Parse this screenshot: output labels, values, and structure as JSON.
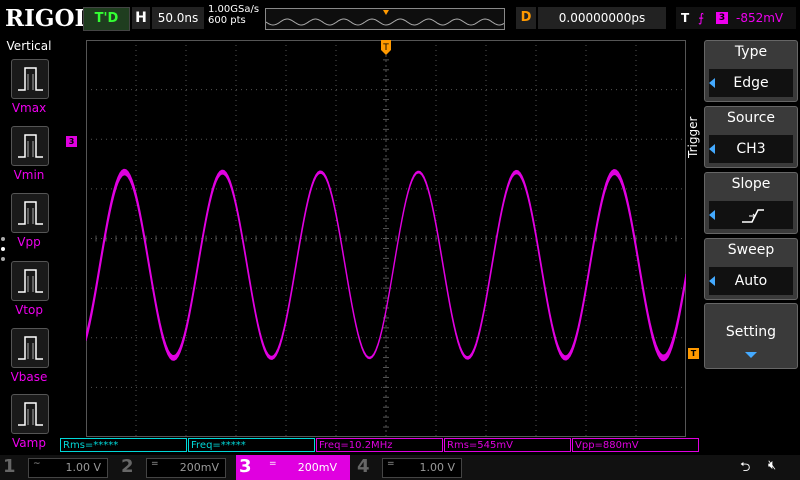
{
  "brand": "RIGOL",
  "run_status": "T'D",
  "horizontal": {
    "label": "H",
    "timebase": "50.0ns",
    "sample_rate": "1.00GSa/s",
    "points": "600 pts"
  },
  "delay": {
    "label": "D",
    "value": "0.00000000ps"
  },
  "trigger_status": {
    "label": "T",
    "edge_icon": "rising-edge-icon",
    "source": "3",
    "level": "-852mV"
  },
  "left_panel": {
    "title": "Vertical",
    "items": [
      {
        "label": "Vmax"
      },
      {
        "label": "Vmin"
      },
      {
        "label": "Vpp"
      },
      {
        "label": "Vtop"
      },
      {
        "label": "Vbase"
      },
      {
        "label": "Vamp"
      }
    ]
  },
  "channel_marker_label": "3",
  "trigger_marker_label": "T",
  "right_menu": {
    "side_title": "Trigger",
    "items": [
      {
        "header": "Type",
        "value": "Edge"
      },
      {
        "header": "Source",
        "value": "CH3"
      },
      {
        "header": "Slope",
        "value": ""
      },
      {
        "header": "Sweep",
        "value": "Auto"
      }
    ],
    "setting": "Setting"
  },
  "measurements": [
    {
      "text": "Rms=*****",
      "color": "#00d8d8"
    },
    {
      "text": "Freq=*****",
      "color": "#00d8d8"
    },
    {
      "text": "Freq=10.2MHz",
      "color": "#e000e0"
    },
    {
      "text": "Rms=545mV",
      "color": "#e000e0"
    },
    {
      "text": "Vpp=880mV",
      "color": "#e000e0"
    }
  ],
  "channels": [
    {
      "num": "1",
      "coupling": "~",
      "scale": "1.00 V",
      "color": "#f0f000",
      "active": false
    },
    {
      "num": "2",
      "coupling": "=",
      "scale": "200mV",
      "color": "#00e0e0",
      "active": false
    },
    {
      "num": "3",
      "coupling": "=",
      "scale": "200mV",
      "color": "#e000e0",
      "active": true
    },
    {
      "num": "4",
      "coupling": "=",
      "scale": "1.00 V",
      "color": "#4060ff",
      "active": false
    }
  ],
  "colors": {
    "ch3": "#e000e0",
    "trigger": "#ff9900",
    "grid": "#555555"
  }
}
